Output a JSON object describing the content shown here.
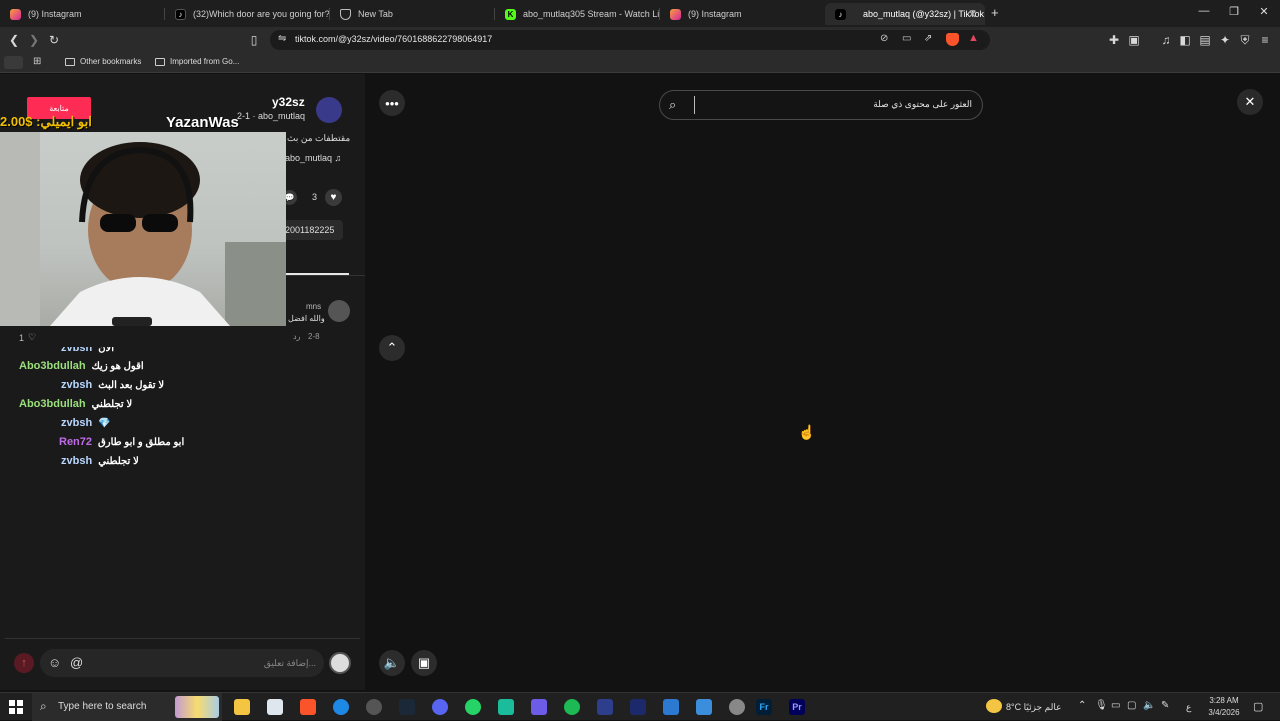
{
  "browser": {
    "tabs": [
      {
        "title": "(9) Instagram",
        "active": false
      },
      {
        "title": "(32)Which door are you going for? | T",
        "active": false
      },
      {
        "title": "New Tab",
        "active": false
      },
      {
        "title": "abo_mutlaq305 Stream - Watch Live o",
        "active": false
      },
      {
        "title": "(9) Instagram",
        "active": false
      },
      {
        "title": "abo_mutlaq (@y32sz) | TikTok",
        "active": true
      }
    ],
    "new_tab": "+",
    "url": "tiktok.com/@y32sz/video/7601688622798064917",
    "bookmarks": [
      "Other bookmarks",
      "Imported from Go..."
    ]
  },
  "post": {
    "username": "y32sz",
    "sub": "2-1 · abo_mutlaq",
    "caption": "مقتطفات من بث",
    "sound": "abo_mutlaq ♫",
    "likes": "3",
    "link_suffix": "2001182225",
    "follow_label": "متابعة"
  },
  "stream_overlay": {
    "streamer_name": "YazanWas",
    "donation": "2.00$ :ابو ايميلي"
  },
  "comment": {
    "user": "mns",
    "text": "والله افضل",
    "date": "2-8",
    "reply": "رد",
    "likes": "1"
  },
  "chat": [
    {
      "user": "zvbsh",
      "msg": "الان",
      "color": "#b9d7ff"
    },
    {
      "user": "Abo3bdullah",
      "msg": "اقول هو زيك",
      "color": "#9be07c"
    },
    {
      "user": "zvbsh",
      "msg": "لا تقول بعد البث",
      "color": "#b9d7ff"
    },
    {
      "user": "Abo3bdullah",
      "msg": "لا تجلطني",
      "color": "#9be07c"
    },
    {
      "user": "zvbsh",
      "msg": "💎",
      "color": "#b9d7ff"
    },
    {
      "user": "Ren72",
      "msg": "ابو مطلق و ابو طارق",
      "color": "#c06ce8"
    },
    {
      "user": "zvbsh",
      "msg": "لا تجلطني",
      "color": "#b9d7ff"
    }
  ],
  "comment_input": {
    "placeholder": "إضافة تعليق..."
  },
  "search": {
    "placeholder": "العثور على محتوى ذي صلة"
  },
  "taskbar": {
    "search_placeholder": "Type here to search",
    "weather": "8°C عالم جزئيًا",
    "lang": "ع",
    "time": "3:28 AM",
    "date": "3/4/2026"
  },
  "colors": {
    "accent": "#fe2c55",
    "chat_green": "#9be07c",
    "chat_blue": "#b9d7ff",
    "chat_purple": "#c06ce8",
    "gold": "#f0c000"
  }
}
